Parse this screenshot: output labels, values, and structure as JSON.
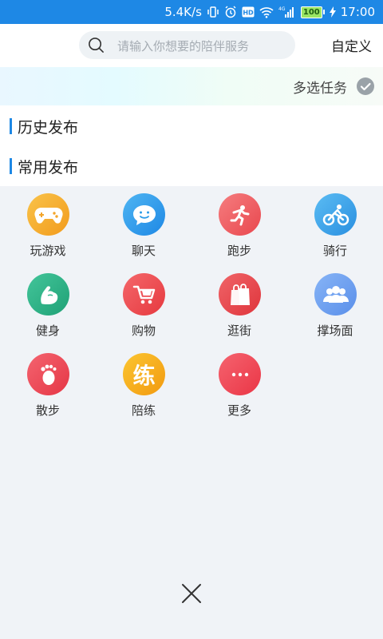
{
  "status_bar": {
    "speed": "5.4K/s",
    "battery": "100",
    "time": "17:00",
    "network": "4G"
  },
  "header": {
    "search_placeholder": "请输入你想要的陪伴服务",
    "custom_label": "自定义"
  },
  "multi_select": {
    "label": "多选任务"
  },
  "sections": {
    "history": "历史发布",
    "common": "常用发布"
  },
  "services": [
    {
      "label": "玩游戏",
      "icon": "gamepad-icon",
      "color": "#f6b133"
    },
    {
      "label": "聊天",
      "icon": "chat-bubble-icon",
      "color": "#2b9be8"
    },
    {
      "label": "跑步",
      "icon": "running-icon",
      "color": "#ef5a5f"
    },
    {
      "label": "骑行",
      "icon": "cycling-icon",
      "color": "#3aa3e6"
    },
    {
      "label": "健身",
      "icon": "fitness-arm-icon",
      "color": "#2fb58a"
    },
    {
      "label": "购物",
      "icon": "shopping-cart-icon",
      "color": "#ee4e55"
    },
    {
      "label": "逛街",
      "icon": "shopping-bag-icon",
      "color": "#e94a50"
    },
    {
      "label": "撑场面",
      "icon": "group-people-icon",
      "color": "#6e9df0"
    },
    {
      "label": "散步",
      "icon": "footprint-icon",
      "color": "#ee4c57"
    },
    {
      "label": "陪练",
      "icon": "practice-char-icon",
      "color": "#f5a623",
      "glyph": "练"
    },
    {
      "label": "更多",
      "icon": "more-dots-icon",
      "color": "#f0495a"
    }
  ]
}
